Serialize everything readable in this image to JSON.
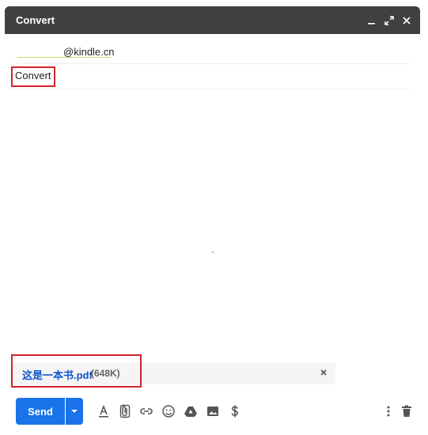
{
  "window": {
    "title": "Convert",
    "controls": [
      "minimize-icon",
      "expand-icon",
      "close-icon"
    ]
  },
  "compose": {
    "to_value": "@kindle.cn",
    "subject_value": "Convert"
  },
  "attachment": {
    "name": "这是一本书.pdf",
    "size": "(648K)",
    "close_symbol": "×"
  },
  "toolbar": {
    "send_label": "Send",
    "icons": [
      "formatting-options-icon",
      "attach-file-icon",
      "insert-link-icon",
      "insert-emoji-icon",
      "google-drive-icon",
      "insert-photo-icon",
      "send-money-icon",
      "more-options-icon",
      "discard-draft-icon"
    ]
  },
  "colors": {
    "titlebar": "#404040",
    "send_button": "#1a73e8",
    "highlight_box": "#d0242b",
    "attachment_link": "#1155cc"
  }
}
